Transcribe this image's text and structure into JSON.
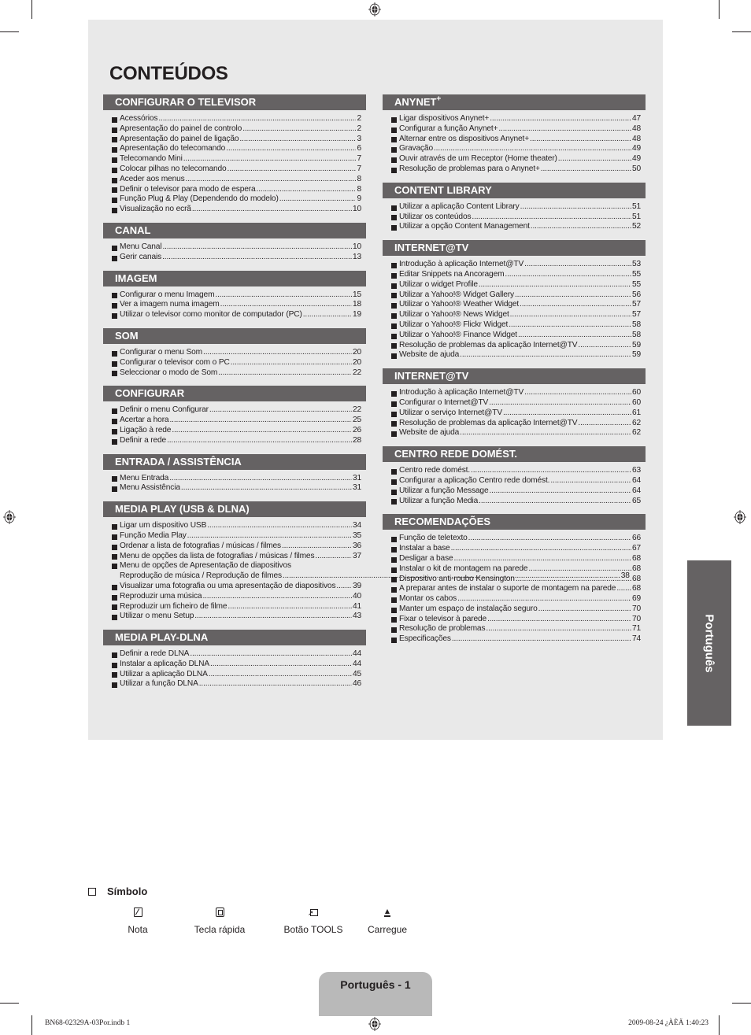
{
  "title": "CONTEÚDOS",
  "left_sections": [
    {
      "heading": "CONFIGURAR O TELEVISOR",
      "items": [
        {
          "label": "Acessórios",
          "page": "2"
        },
        {
          "label": "Apresentação do painel de controlo",
          "page": "2"
        },
        {
          "label": "Apresentação do painel de ligação",
          "page": "3"
        },
        {
          "label": "Apresentação do telecomando",
          "page": "6"
        },
        {
          "label": "Telecomando Mini",
          "page": "7"
        },
        {
          "label": "Colocar pilhas no telecomando",
          "page": "7"
        },
        {
          "label": "Aceder aos menus",
          "page": "8"
        },
        {
          "label": "Definir o televisor para modo de espera",
          "page": "8"
        },
        {
          "label": "Função Plug & Play (Dependendo do modelo)",
          "page": "9"
        },
        {
          "label": "Visualização no ecrã",
          "page": "10"
        }
      ]
    },
    {
      "heading": "CANAL",
      "items": [
        {
          "label": "Menu Canal",
          "page": "10"
        },
        {
          "label": "Gerir canais",
          "page": "13"
        }
      ]
    },
    {
      "heading": "IMAGEM",
      "items": [
        {
          "label": "Configurar o menu Imagem",
          "page": "15"
        },
        {
          "label": "Ver a imagem numa imagem",
          "page": "18"
        },
        {
          "label": "Utilizar o televisor como monitor de computador (PC)",
          "page": "19"
        }
      ]
    },
    {
      "heading": "SOM",
      "items": [
        {
          "label": "Configurar o menu Som",
          "page": "20"
        },
        {
          "label": "Configurar o televisor com o PC",
          "page": "20"
        },
        {
          "label": "Seleccionar o modo de Som",
          "page": "22"
        }
      ]
    },
    {
      "heading": "CONFIGURAR",
      "items": [
        {
          "label": "Definir o menu Configurar",
          "page": "22"
        },
        {
          "label": "Acertar a hora",
          "page": "25"
        },
        {
          "label": "Ligação à rede",
          "page": "26"
        },
        {
          "label": "Definir a rede",
          "page": "28"
        }
      ]
    },
    {
      "heading": "ENTRADA / ASSISTÊNCIA",
      "items": [
        {
          "label": "Menu Entrada",
          "page": "31"
        },
        {
          "label": "Menu Assistência",
          "page": "31"
        }
      ]
    },
    {
      "heading": "MEDIA PLAY (USB & DLNA)",
      "items": [
        {
          "label": "Ligar um dispositivo USB",
          "page": "34"
        },
        {
          "label": "Função Media Play",
          "page": "35"
        },
        {
          "label": "Ordenar a lista de fotografias / músicas / filmes",
          "page": "36"
        },
        {
          "label": "Menu de opções da lista de fotografias / músicas / filmes",
          "page": "37"
        },
        {
          "label": "Menu de opções de Apresentação de diapositivos",
          "label2": "Reprodução de música / Reprodução de filmes",
          "page": "38"
        },
        {
          "label": "Visualizar uma fotografia ou uma apresentação de diapositivos",
          "page": "39"
        },
        {
          "label": "Reproduzir uma música",
          "page": "40"
        },
        {
          "label": "Reproduzir um ficheiro de filme",
          "page": "41"
        },
        {
          "label": "Utilizar o menu Setup",
          "page": "43"
        }
      ]
    },
    {
      "heading": "MEDIA PLAY-DLNA",
      "items": [
        {
          "label": "Definir a rede DLNA",
          "page": "44"
        },
        {
          "label": "Instalar a aplicação DLNA",
          "page": "44"
        },
        {
          "label": "Utilizar a aplicação DLNA",
          "page": "45"
        },
        {
          "label": "Utilizar a função DLNA",
          "page": "46"
        }
      ]
    }
  ],
  "right_sections": [
    {
      "heading": "ANYNET",
      "heading_sup": "+",
      "items": [
        {
          "label": "Ligar dispositivos Anynet+",
          "page": "47"
        },
        {
          "label": "Configurar a função Anynet+",
          "page": "48"
        },
        {
          "label": "Alternar entre os dispositivos Anynet+",
          "page": "48"
        },
        {
          "label": "Gravação",
          "page": "49"
        },
        {
          "label": "Ouvir através de um Receptor (Home theater)",
          "page": "49"
        },
        {
          "label": "Resolução de problemas para o Anynet+",
          "page": "50"
        }
      ]
    },
    {
      "heading": "CONTENT LIBRARY",
      "items": [
        {
          "label": "Utilizar a aplicação Content Library",
          "page": "51"
        },
        {
          "label": "Utilizar os conteúdos",
          "page": "51"
        },
        {
          "label": "Utilizar a opção Content Management",
          "page": "52"
        }
      ]
    },
    {
      "heading": "INTERNET@TV",
      "items": [
        {
          "label": "Introdução à aplicação Internet@TV",
          "page": "53"
        },
        {
          "label": "Editar Snippets na Ancoragem",
          "page": "55"
        },
        {
          "label": "Utilizar o widget Profile",
          "page": "55"
        },
        {
          "label": "Utilizar a Yahoo!® Widget Gallery",
          "page": "56"
        },
        {
          "label": "Utilizar o Yahoo!® Weather Widget",
          "page": "57"
        },
        {
          "label": "Utilizar o Yahoo!® News Widget",
          "page": "57"
        },
        {
          "label": "Utilizar o Yahoo!® Flickr Widget",
          "page": "58"
        },
        {
          "label": "Utilizar o Yahoo!® Finance Widget",
          "page": "58"
        },
        {
          "label": "Resolução de problemas da aplicação Internet@TV",
          "page": "59"
        },
        {
          "label": "Website de ajuda",
          "page": "59"
        }
      ]
    },
    {
      "heading": "INTERNET@TV",
      "items": [
        {
          "label": "Introdução à aplicação Internet@TV",
          "page": "60"
        },
        {
          "label": "Configurar o Internet@TV",
          "page": "60"
        },
        {
          "label": "Utilizar o serviço Internet@TV",
          "page": "61"
        },
        {
          "label": "Resolução de problemas da aplicação Internet@TV",
          "page": "62"
        },
        {
          "label": "Website de ajuda",
          "page": "62"
        }
      ]
    },
    {
      "heading": "CENTRO REDE DOMÉST.",
      "items": [
        {
          "label": "Centro rede domést.",
          "page": "63"
        },
        {
          "label": "Configurar a aplicação Centro rede domést.",
          "page": "64"
        },
        {
          "label": "Utilizar a função Message",
          "page": "64"
        },
        {
          "label": "Utilizar a função Media",
          "page": "65"
        }
      ]
    },
    {
      "heading": "RECOMENDAÇÕES",
      "items": [
        {
          "label": "Função de teletexto",
          "page": "66"
        },
        {
          "label": "Instalar a base",
          "page": "67"
        },
        {
          "label": "Desligar a base",
          "page": "68"
        },
        {
          "label": "Instalar o kit de montagem na parede",
          "page": "68"
        },
        {
          "label": "Dispositivo anti-roubo Kensington",
          "page": "68"
        },
        {
          "label": "A preparar antes de instalar o suporte de montagem na parede",
          "page": "68"
        },
        {
          "label": "Montar os cabos",
          "page": "69"
        },
        {
          "label": "Manter um espaço de instalação seguro",
          "page": "70"
        },
        {
          "label": "Fixar o televisor à parede",
          "page": "70"
        },
        {
          "label": "Resolução de problemas",
          "page": "71"
        },
        {
          "label": "Especificações",
          "page": "74"
        }
      ]
    }
  ],
  "side_tab": "Português",
  "symbols": {
    "heading": "Símbolo",
    "items": [
      {
        "icon": "note-icon",
        "label": "Nota"
      },
      {
        "icon": "quick-key-icon",
        "label": "Tecla rápida"
      },
      {
        "icon": "tools-button-icon",
        "label": "Botão TOOLS"
      },
      {
        "icon": "press-icon",
        "label": "Carregue"
      }
    ]
  },
  "page_number": "Português - 1",
  "footer": {
    "file": "BN68-02329A-03Por.indb   1",
    "timestamp": "2009-08-24   ¿ÀÈÄ 1:40:23"
  }
}
